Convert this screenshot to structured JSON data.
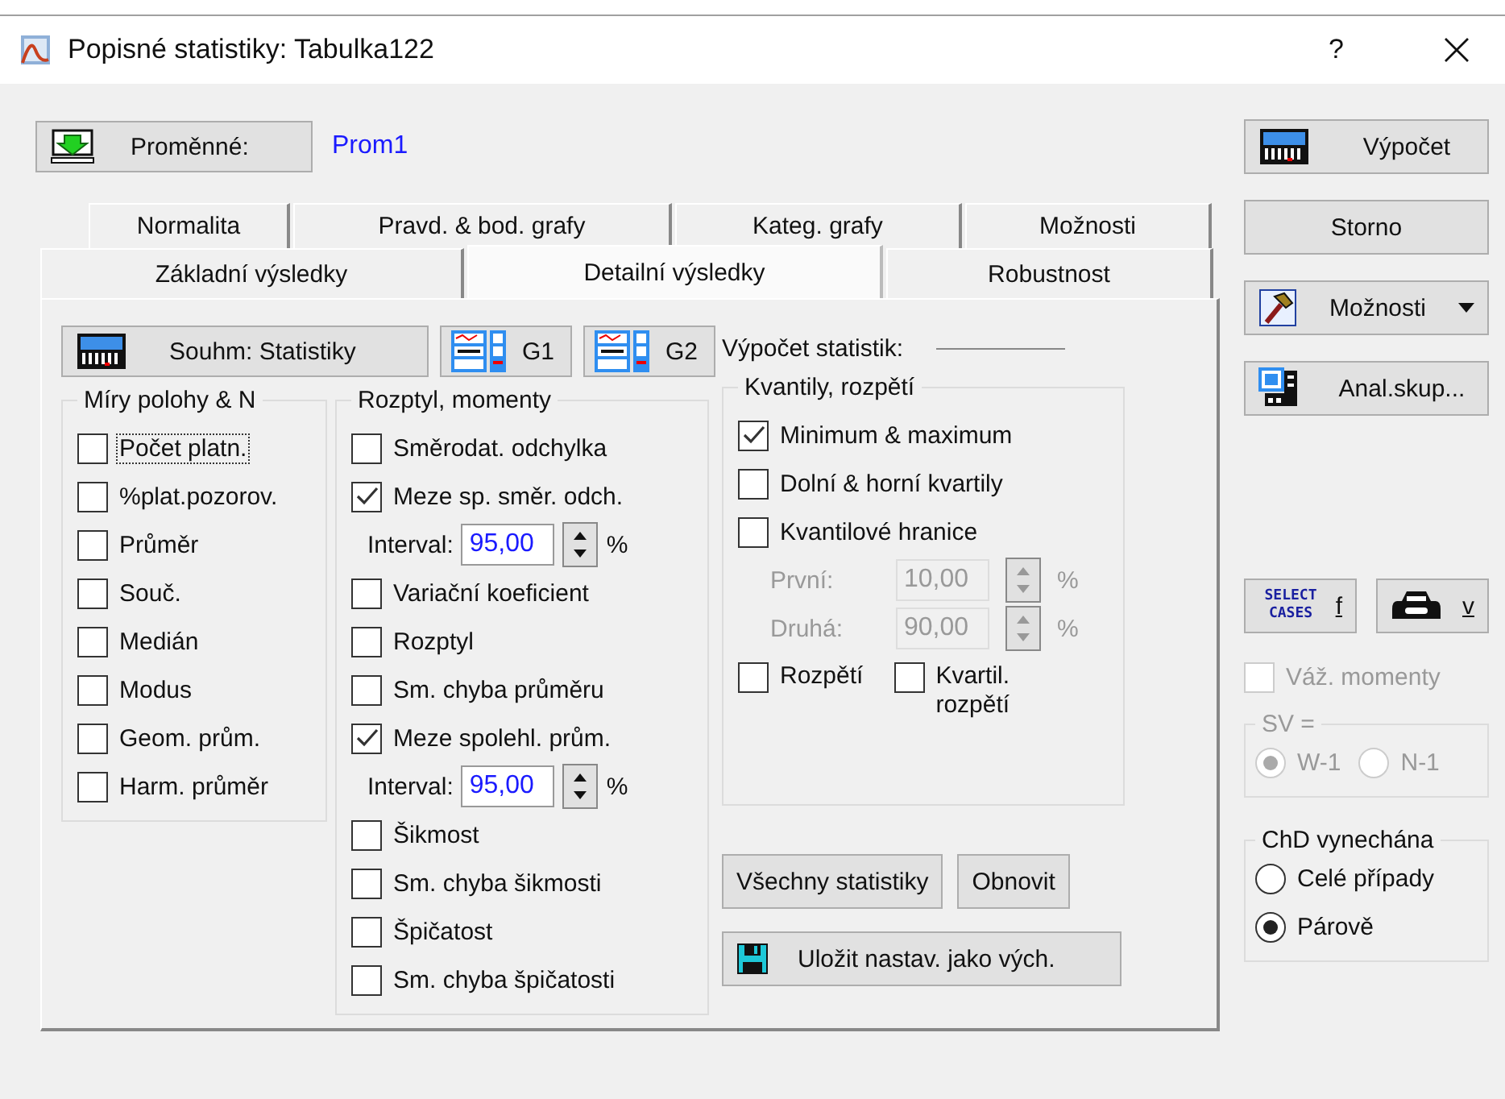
{
  "window": {
    "title": "Popisné statistiky: Tabulka122",
    "help": "?"
  },
  "variables": {
    "button": "Proměnné:",
    "value": "Prom1"
  },
  "tab_rows": [
    [
      {
        "label": "Normalita",
        "selected": false
      },
      {
        "label": "Pravd. & bod. grafy",
        "selected": false
      },
      {
        "label": "Kateg. grafy",
        "selected": false
      },
      {
        "label": "Možnosti",
        "selected": false
      }
    ],
    [
      {
        "label": "Základní výsledky",
        "selected": false
      },
      {
        "label": "Detailní výsledky",
        "selected": true
      },
      {
        "label": "Robustnost",
        "selected": false
      }
    ]
  ],
  "toolbar": {
    "summary_button": "Souhm: Statistiky",
    "graph_buttons": [
      "G1",
      "G2"
    ],
    "compute_label": "Výpočet statistik:"
  },
  "groups": [
    {
      "title": "Míry polohy & N",
      "items": [
        {
          "kind": "checkbox",
          "label": "Počet platn.",
          "checked": false,
          "focused": true
        },
        {
          "kind": "checkbox",
          "label": "%plat.pozorov.",
          "checked": false
        },
        {
          "kind": "checkbox",
          "label": "Průměr",
          "checked": false
        },
        {
          "kind": "checkbox",
          "label": "Souč.",
          "checked": false
        },
        {
          "kind": "checkbox",
          "label": "Medián",
          "checked": false
        },
        {
          "kind": "checkbox",
          "label": "Modus",
          "checked": false
        },
        {
          "kind": "checkbox",
          "label": "Geom. prům.",
          "checked": false
        },
        {
          "kind": "checkbox",
          "label": "Harm. průměr",
          "checked": false
        }
      ]
    },
    {
      "title": "Rozptyl, momenty",
      "items": [
        {
          "kind": "checkbox",
          "label": "Směrodat. odchylka",
          "checked": false
        },
        {
          "kind": "checkbox",
          "label": "Meze sp. směr. odch.",
          "checked": true
        },
        {
          "kind": "spin",
          "label": "Interval:",
          "value": "95,00",
          "unit": "%",
          "disabled": false
        },
        {
          "kind": "checkbox",
          "label": "Variační koeficient",
          "checked": false
        },
        {
          "kind": "checkbox",
          "label": "Rozptyl",
          "checked": false
        },
        {
          "kind": "checkbox",
          "label": "Sm. chyba průměru",
          "checked": false
        },
        {
          "kind": "checkbox",
          "label": "Meze spolehl. prům.",
          "checked": true
        },
        {
          "kind": "spin",
          "label": "Interval:",
          "value": "95,00",
          "unit": "%",
          "disabled": false
        },
        {
          "kind": "checkbox",
          "label": "Šikmost",
          "checked": false
        },
        {
          "kind": "checkbox",
          "label": "Sm. chyba šikmosti",
          "checked": false
        },
        {
          "kind": "checkbox",
          "label": "Špičatost",
          "checked": false
        },
        {
          "kind": "checkbox",
          "label": "Sm. chyba špičatosti",
          "checked": false
        }
      ]
    },
    {
      "title": "Kvantily, rozpětí",
      "items": [
        {
          "kind": "checkbox",
          "label": "Minimum & maximum",
          "checked": true
        },
        {
          "kind": "checkbox",
          "label": "Dolní & horní kvartily",
          "checked": false
        },
        {
          "kind": "checkbox",
          "label": "Kvantilové hranice",
          "checked": false
        },
        {
          "kind": "spin",
          "label": "První:",
          "value": "10,00",
          "unit": "%",
          "disabled": true
        },
        {
          "kind": "spin",
          "label": "Druhá:",
          "value": "90,00",
          "unit": "%",
          "disabled": true
        },
        {
          "kind": "pair",
          "items": [
            {
              "label": "Rozpětí",
              "checked": false
            },
            {
              "label": "Kvartil. rozpětí",
              "checked": false
            }
          ]
        }
      ]
    }
  ],
  "panel_buttons": [
    "Všechny statistiky",
    "Obnovit"
  ],
  "save_button": "Uložit nastav. jako vých.",
  "side": {
    "compute": "Výpočet",
    "cancel": "Storno",
    "options": "Možnosti",
    "by_group": "Anal.skup...",
    "select_cases_icon": "SELECT CASES",
    "select_cases_button": "f",
    "weight_button": "v"
  },
  "weighted": {
    "label": "Váž. momenty",
    "checked": false,
    "disabled": true
  },
  "sv_group": {
    "title": "SV =",
    "disabled": true,
    "options": [
      {
        "label": "W-1",
        "selected": true
      },
      {
        "label": "N-1",
        "selected": false
      }
    ]
  },
  "md_group": {
    "title": "ChD vynechána",
    "disabled": false,
    "options": [
      {
        "label": "Celé případy",
        "selected": false
      },
      {
        "label": "Párově",
        "selected": true
      }
    ]
  }
}
